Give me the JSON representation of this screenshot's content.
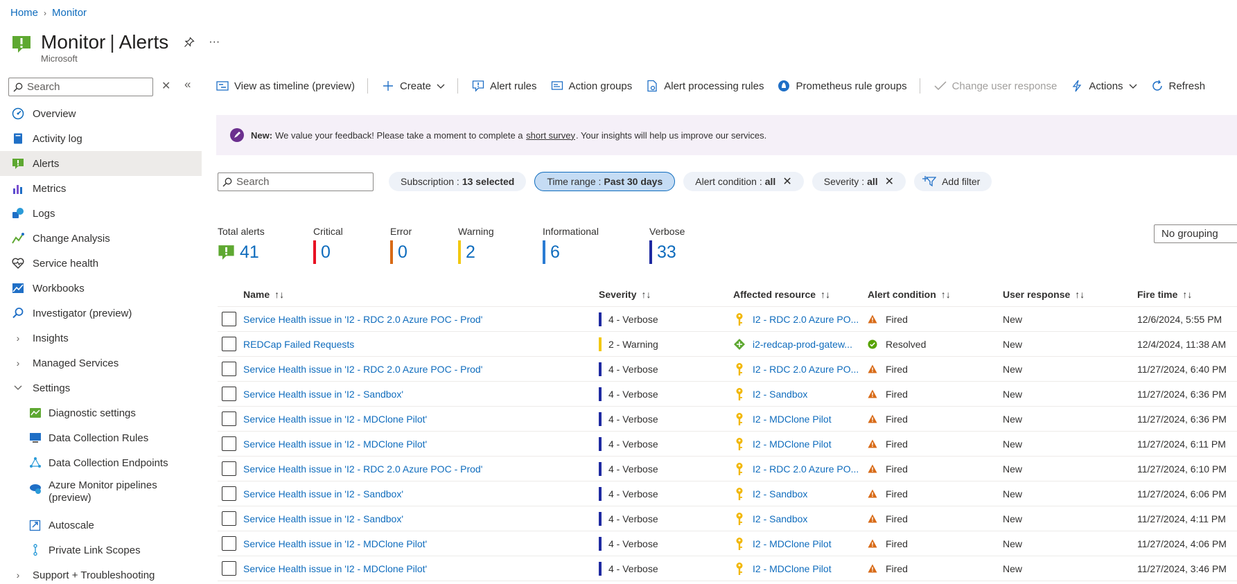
{
  "breadcrumb": {
    "home": "Home",
    "monitor": "Monitor"
  },
  "header": {
    "title_main": "Monitor",
    "title_sub": "Alerts",
    "publisher": "Microsoft",
    "more": "···"
  },
  "sidebar": {
    "search_placeholder": "Search",
    "items": [
      {
        "label": "Overview",
        "icon": "gauge-icon"
      },
      {
        "label": "Activity log",
        "icon": "book-icon"
      },
      {
        "label": "Alerts",
        "icon": "alert-icon",
        "active": true
      },
      {
        "label": "Metrics",
        "icon": "bar-chart-icon"
      },
      {
        "label": "Logs",
        "icon": "logs-icon"
      },
      {
        "label": "Change Analysis",
        "icon": "change-analysis-icon"
      },
      {
        "label": "Service health",
        "icon": "heart-icon"
      },
      {
        "label": "Workbooks",
        "icon": "workbook-icon"
      },
      {
        "label": "Investigator (preview)",
        "icon": "magnifier-icon"
      },
      {
        "label": "Insights",
        "icon": "chevron-right-icon"
      },
      {
        "label": "Managed Services",
        "icon": "chevron-right-icon"
      },
      {
        "label": "Settings",
        "icon": "chevron-down-icon"
      },
      {
        "label": "Diagnostic settings",
        "icon": "diagnostic-icon"
      },
      {
        "label": "Data Collection Rules",
        "icon": "dcr-icon"
      },
      {
        "label": "Data Collection Endpoints",
        "icon": "dce-icon"
      },
      {
        "label": "Azure Monitor pipelines",
        "label2": "(preview)",
        "icon": "pipeline-icon"
      },
      {
        "label": "Autoscale",
        "icon": "autoscale-icon"
      },
      {
        "label": "Private Link Scopes",
        "icon": "link-scope-icon"
      },
      {
        "label": "Support + Troubleshooting",
        "icon": "chevron-right-icon"
      }
    ]
  },
  "toolbar": {
    "timeline": "View as timeline (preview)",
    "create": "Create",
    "alert_rules": "Alert rules",
    "action_groups": "Action groups",
    "processing_rules": "Alert processing rules",
    "prometheus": "Prometheus rule groups",
    "change_response": "Change user response",
    "actions": "Actions",
    "refresh": "Refresh"
  },
  "banner": {
    "new": "New:",
    "text1": "We value your feedback! Please take a moment to complete a",
    "link": "short survey",
    "text2": ". Your insights will help us improve our services."
  },
  "filters": {
    "search_placeholder": "Search",
    "subscription_label": "Subscription :",
    "subscription_value": "13 selected",
    "time_label": "Time range :",
    "time_value": "Past 30 days",
    "condition_label": "Alert condition :",
    "condition_value": "all",
    "severity_label": "Severity :",
    "severity_value": "all",
    "add_filter": "Add filter"
  },
  "summary": {
    "total_label": "Total alerts",
    "total": "41",
    "critical_label": "Critical",
    "critical": "0",
    "error_label": "Error",
    "error": "0",
    "warning_label": "Warning",
    "warning": "2",
    "info_label": "Informational",
    "info": "6",
    "verbose_label": "Verbose",
    "verbose": "33",
    "grouping": "No grouping"
  },
  "colors": {
    "critical": "#e81123",
    "error": "#d86a16",
    "warning": "#f2c811",
    "informational": "#2b7cd3",
    "verbose": "#1f2aa1",
    "link": "#0f6cbd"
  },
  "table": {
    "headers": {
      "name": "Name",
      "severity": "Severity",
      "resource": "Affected resource",
      "condition": "Alert condition",
      "response": "User response",
      "fire_time": "Fire time"
    },
    "rows": [
      {
        "name": "Service Health issue in 'I2 - RDC 2.0 Azure POC - Prod'",
        "severity": "4 - Verbose",
        "sev_color": "#1f2aa1",
        "resource": "I2 - RDC 2.0 Azure PO...",
        "res_icon": "key-icon",
        "condition": "Fired",
        "response": "New",
        "fire_time": "12/6/2024, 5:55 PM"
      },
      {
        "name": "REDCap Failed Requests",
        "severity": "2 - Warning",
        "sev_color": "#f2c811",
        "resource": "i2-redcap-prod-gatew...",
        "res_icon": "gateway-icon",
        "condition": "Resolved",
        "response": "New",
        "fire_time": "12/4/2024, 11:38 AM"
      },
      {
        "name": "Service Health issue in 'I2 - RDC 2.0 Azure POC - Prod'",
        "severity": "4 - Verbose",
        "sev_color": "#1f2aa1",
        "resource": "I2 - RDC 2.0 Azure PO...",
        "res_icon": "key-icon",
        "condition": "Fired",
        "response": "New",
        "fire_time": "11/27/2024, 6:40 PM"
      },
      {
        "name": "Service Health issue in 'I2 - Sandbox'",
        "severity": "4 - Verbose",
        "sev_color": "#1f2aa1",
        "resource": "I2 - Sandbox",
        "res_icon": "key-icon",
        "condition": "Fired",
        "response": "New",
        "fire_time": "11/27/2024, 6:36 PM"
      },
      {
        "name": "Service Health issue in 'I2 - MDClone Pilot'",
        "severity": "4 - Verbose",
        "sev_color": "#1f2aa1",
        "resource": "I2 - MDClone Pilot",
        "res_icon": "key-icon",
        "condition": "Fired",
        "response": "New",
        "fire_time": "11/27/2024, 6:36 PM"
      },
      {
        "name": "Service Health issue in 'I2 - MDClone Pilot'",
        "severity": "4 - Verbose",
        "sev_color": "#1f2aa1",
        "resource": "I2 - MDClone Pilot",
        "res_icon": "key-icon",
        "condition": "Fired",
        "response": "New",
        "fire_time": "11/27/2024, 6:11 PM"
      },
      {
        "name": "Service Health issue in 'I2 - RDC 2.0 Azure POC - Prod'",
        "severity": "4 - Verbose",
        "sev_color": "#1f2aa1",
        "resource": "I2 - RDC 2.0 Azure PO...",
        "res_icon": "key-icon",
        "condition": "Fired",
        "response": "New",
        "fire_time": "11/27/2024, 6:10 PM"
      },
      {
        "name": "Service Health issue in 'I2 - Sandbox'",
        "severity": "4 - Verbose",
        "sev_color": "#1f2aa1",
        "resource": "I2 - Sandbox",
        "res_icon": "key-icon",
        "condition": "Fired",
        "response": "New",
        "fire_time": "11/27/2024, 6:06 PM"
      },
      {
        "name": "Service Health issue in 'I2 - Sandbox'",
        "severity": "4 - Verbose",
        "sev_color": "#1f2aa1",
        "resource": "I2 - Sandbox",
        "res_icon": "key-icon",
        "condition": "Fired",
        "response": "New",
        "fire_time": "11/27/2024, 4:11 PM"
      },
      {
        "name": "Service Health issue in 'I2 - MDClone Pilot'",
        "severity": "4 - Verbose",
        "sev_color": "#1f2aa1",
        "resource": "I2 - MDClone Pilot",
        "res_icon": "key-icon",
        "condition": "Fired",
        "response": "New",
        "fire_time": "11/27/2024, 4:06 PM"
      },
      {
        "name": "Service Health issue in 'I2 - MDClone Pilot'",
        "severity": "4 - Verbose",
        "sev_color": "#1f2aa1",
        "resource": "I2 - MDClone Pilot",
        "res_icon": "key-icon",
        "condition": "Fired",
        "response": "New",
        "fire_time": "11/27/2024, 3:46 PM"
      }
    ]
  }
}
